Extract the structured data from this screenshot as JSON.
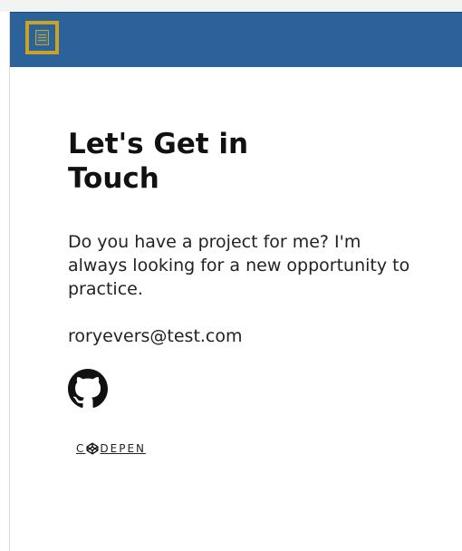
{
  "header": {
    "menu_icon": "hamburger-menu-icon",
    "colors": {
      "navbar": "#2b6299",
      "accent": "#c9a227"
    }
  },
  "contact": {
    "title": "Let's Get in Touch",
    "description": "Do you have a project for me? I'm always looking for a new opportunity to practice.",
    "email": "roryevers@test.com"
  },
  "social": {
    "github_icon": "github-icon",
    "codepen": {
      "prefix": "C",
      "suffix": "DEPEN",
      "icon": "codepen-icon"
    }
  }
}
